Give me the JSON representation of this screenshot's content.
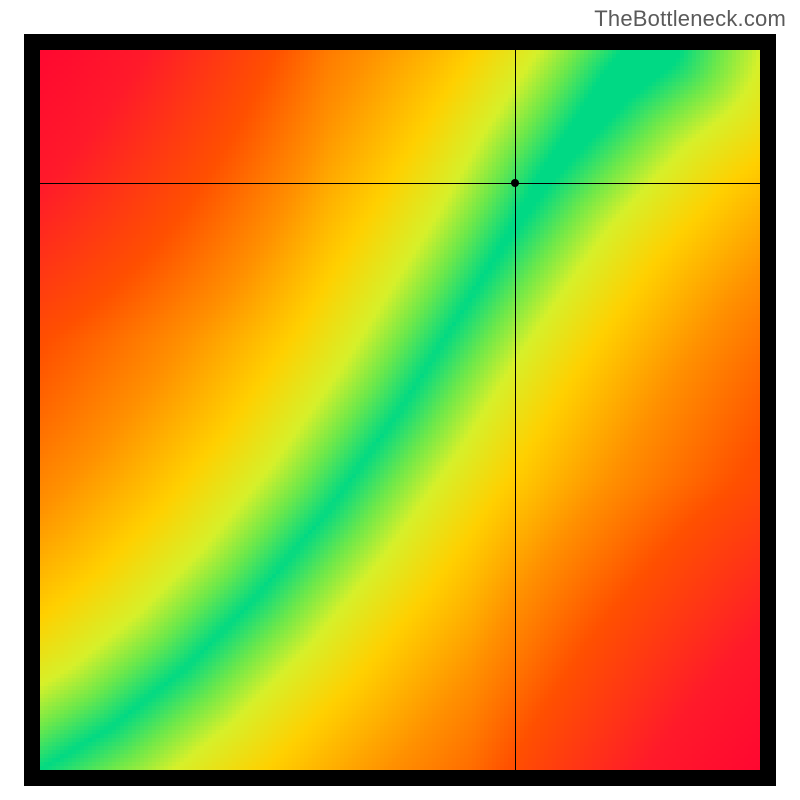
{
  "attribution": "TheBottleneck.com",
  "chart_data": {
    "type": "heatmap",
    "title": "",
    "xlabel": "",
    "ylabel": "",
    "xlim": [
      0,
      1
    ],
    "ylim": [
      0,
      1
    ],
    "crosshair": {
      "x": 0.66,
      "y": 0.815
    },
    "marker": {
      "x": 0.66,
      "y": 0.815
    },
    "optimal_curve": {
      "description": "Green ridge indicating optimal pairing; monotone increasing, steeper near origin",
      "points": [
        {
          "x": 0.0,
          "y": 0.0
        },
        {
          "x": 0.1,
          "y": 0.06
        },
        {
          "x": 0.2,
          "y": 0.14
        },
        {
          "x": 0.3,
          "y": 0.24
        },
        {
          "x": 0.4,
          "y": 0.36
        },
        {
          "x": 0.5,
          "y": 0.5
        },
        {
          "x": 0.6,
          "y": 0.66
        },
        {
          "x": 0.7,
          "y": 0.82
        },
        {
          "x": 0.8,
          "y": 0.95
        },
        {
          "x": 0.85,
          "y": 1.0
        }
      ]
    },
    "colormap": {
      "description": "Distance from optimal curve maps red→orange→yellow→green; far corners fade toward red (top-left, bottom-right) and yellow (top-right)",
      "stops": [
        {
          "d": 0.0,
          "color": "#00d984"
        },
        {
          "d": 0.05,
          "color": "#6de84a"
        },
        {
          "d": 0.1,
          "color": "#d6f02a"
        },
        {
          "d": 0.18,
          "color": "#ffd000"
        },
        {
          "d": 0.3,
          "color": "#ff9000"
        },
        {
          "d": 0.45,
          "color": "#ff5000"
        },
        {
          "d": 0.7,
          "color": "#ff1a2a"
        },
        {
          "d": 1.0,
          "color": "#ff0033"
        }
      ]
    },
    "resolution": 180
  }
}
